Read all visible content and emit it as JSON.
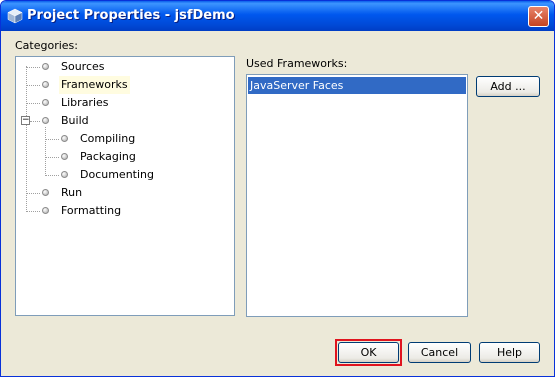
{
  "window": {
    "title": "Project Properties - jsfDemo",
    "close_glyph": "✕"
  },
  "categories": {
    "label": "Categories:",
    "items": [
      {
        "label": "Sources"
      },
      {
        "label": "Frameworks",
        "selected": true
      },
      {
        "label": "Libraries"
      },
      {
        "label": "Build",
        "expanded": true
      },
      {
        "label": "Compiling",
        "child": true
      },
      {
        "label": "Packaging",
        "child": true
      },
      {
        "label": "Documenting",
        "child": true
      },
      {
        "label": "Run"
      },
      {
        "label": "Formatting"
      }
    ]
  },
  "frameworks": {
    "label": "Used Frameworks:",
    "items": [
      "JavaServer Faces"
    ],
    "add_button": "Add ..."
  },
  "footer": {
    "ok": "OK",
    "cancel": "Cancel",
    "help": "Help"
  },
  "colors": {
    "title_bar": "#0058EE",
    "selection": "#316AC5",
    "highlight_frame": "#E0141E"
  }
}
